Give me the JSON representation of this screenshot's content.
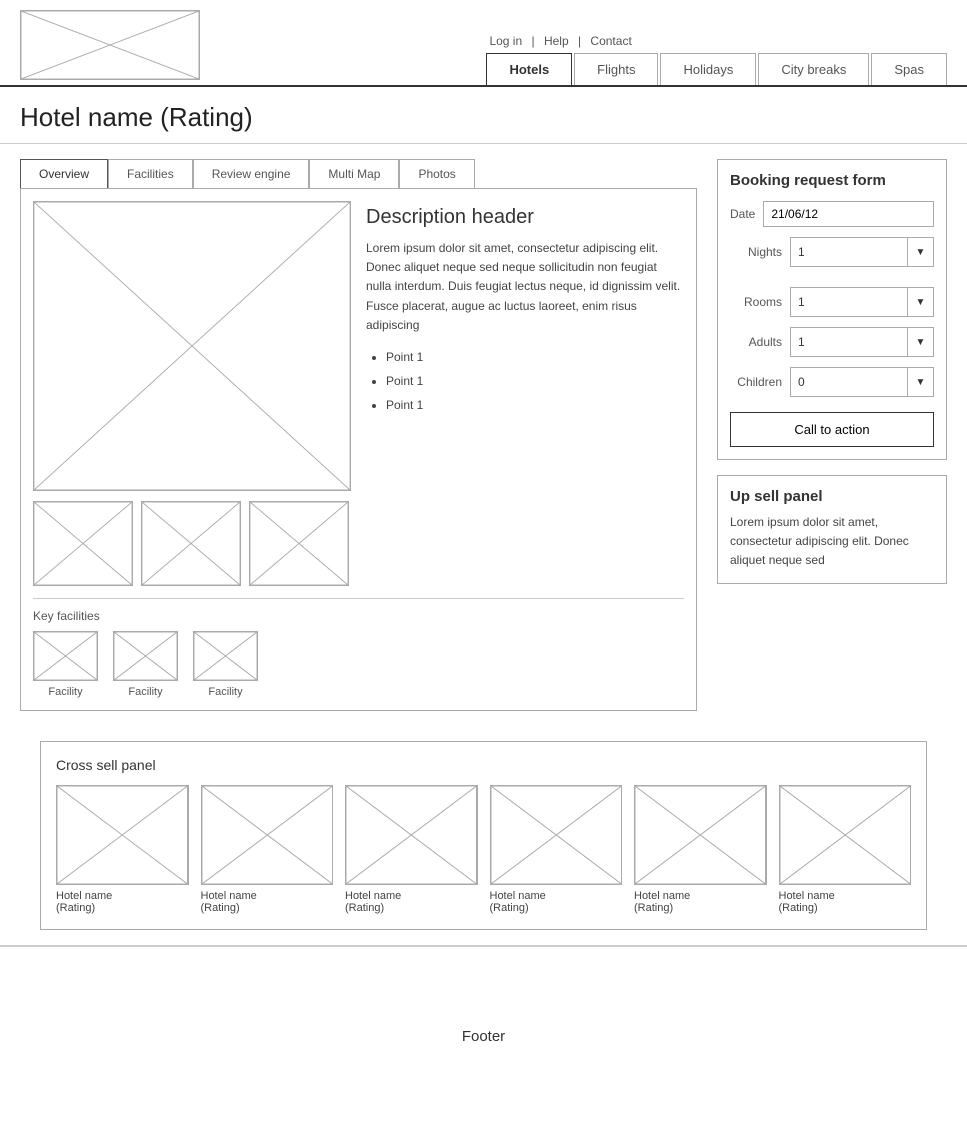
{
  "header": {
    "nav_top": {
      "login": "Log in",
      "separator1": "|",
      "help": "Help",
      "separator2": "|",
      "contact": "Contact"
    },
    "tabs": [
      {
        "label": "Hotels",
        "active": true
      },
      {
        "label": "Flights",
        "active": false
      },
      {
        "label": "Holidays",
        "active": false
      },
      {
        "label": "City breaks",
        "active": false
      },
      {
        "label": "Spas",
        "active": false
      }
    ]
  },
  "page": {
    "title": "Hotel name (Rating)"
  },
  "content_tabs": [
    {
      "label": "Overview",
      "active": true
    },
    {
      "label": "Facilities",
      "active": false
    },
    {
      "label": "Review engine",
      "active": false
    },
    {
      "label": "Multi Map",
      "active": false
    },
    {
      "label": "Photos",
      "active": false
    }
  ],
  "description": {
    "header": "Description header",
    "body": "Lorem ipsum dolor sit amet, consectetur adipiscing elit. Donec aliquet neque sed neque sollicitudin non feugiat nulla interdum. Duis feugiat lectus neque, id dignissim velit. Fusce placerat, augue ac luctus laoreet, enim risus adipiscing",
    "bullets": [
      "Point 1",
      "Point 1",
      "Point 1"
    ]
  },
  "facilities": {
    "label": "Key facilities",
    "items": [
      {
        "label": "Facility"
      },
      {
        "label": "Facility"
      },
      {
        "label": "Facility"
      }
    ]
  },
  "booking_form": {
    "title": "Booking request form",
    "fields": [
      {
        "label": "Date",
        "type": "input",
        "value": "21/06/12"
      },
      {
        "label": "Nights",
        "type": "select",
        "value": "1"
      },
      {
        "label": "Rooms",
        "type": "select",
        "value": "1"
      },
      {
        "label": "Adults",
        "type": "select",
        "value": "1"
      },
      {
        "label": "Children",
        "type": "select",
        "value": "0"
      }
    ],
    "cta_label": "Call to action"
  },
  "upsell": {
    "title": "Up sell panel",
    "text": "Lorem ipsum dolor sit amet, consectetur adipiscing elit. Donec aliquet neque sed"
  },
  "cross_sell": {
    "title": "Cross sell panel",
    "items": [
      {
        "label": "Hotel name\n(Rating)"
      },
      {
        "label": "Hotel name\n(Rating)"
      },
      {
        "label": "Hotel name\n(Rating)"
      },
      {
        "label": "Hotel name\n(Rating)"
      },
      {
        "label": "Hotel name\n(Rating)"
      },
      {
        "label": "Hotel name\n(Rating)"
      }
    ]
  },
  "footer": {
    "label": "Footer"
  }
}
